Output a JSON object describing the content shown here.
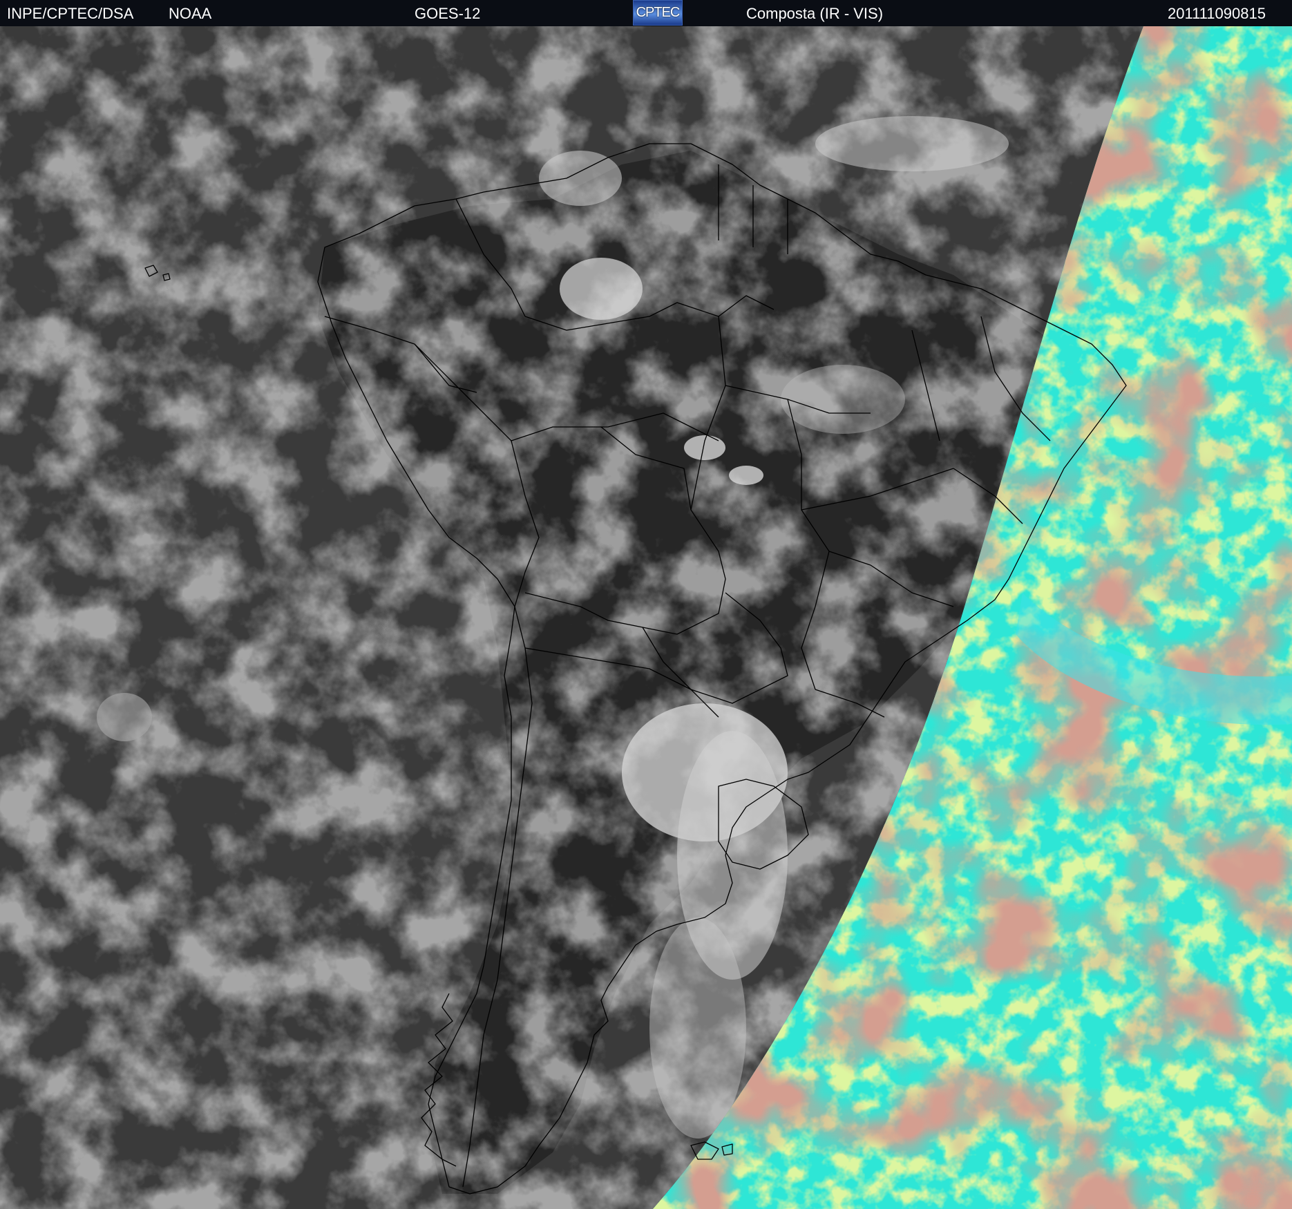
{
  "header": {
    "org": "INPE/CPTEC/DSA",
    "agency": "NOAA",
    "satellite": "GOES-12",
    "logo_text": "CPTEC",
    "product": "Composta (IR - VIS)",
    "timestamp": "201111090815"
  },
  "colors": {
    "header_bg": "#0a0d14",
    "ir_background": "#3a3a3a",
    "cloud_white": "#d8d8d8",
    "coastline": "#000000",
    "vis_cyan": "#2ee6d6",
    "vis_green": "#b8e85a",
    "vis_red": "#a85a4a"
  }
}
